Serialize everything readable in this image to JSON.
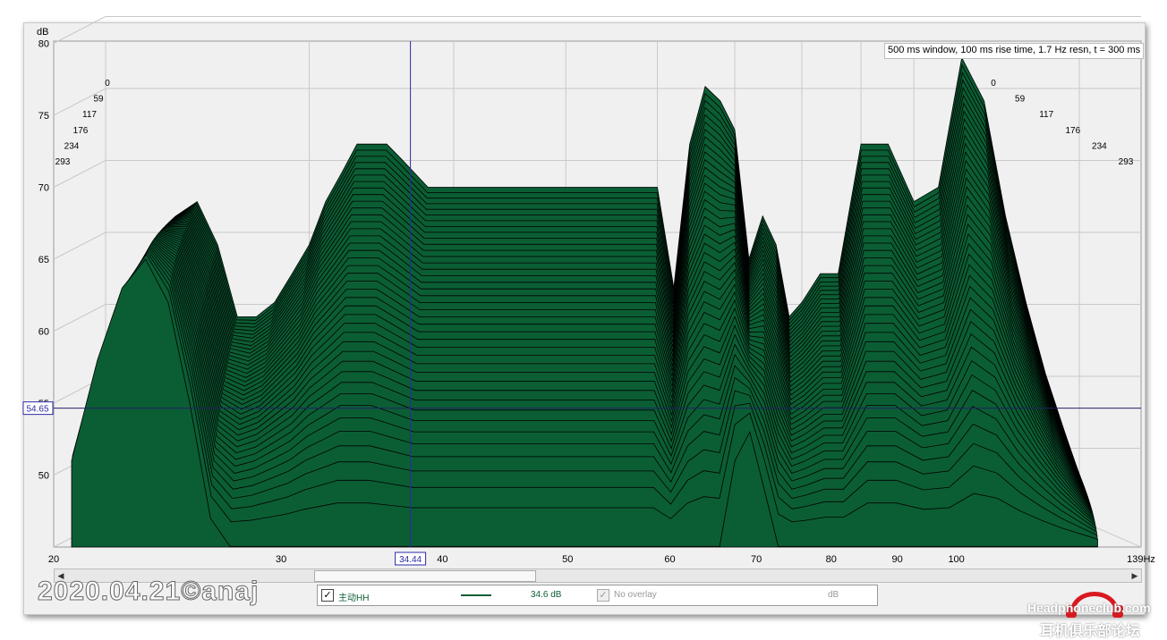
{
  "chart_data": {
    "type": "area",
    "title": "500 ms window, 100 ms rise time,  1.7 Hz resn, t = 300 ms",
    "xlabel": "",
    "ylabel": "dB",
    "xscale": "log",
    "xlim": [
      20,
      139
    ],
    "ylim": [
      45,
      80
    ],
    "x_ticks": [
      "20",
      "30",
      "40",
      "50",
      "60",
      "70",
      "80",
      "90",
      "100",
      "139Hz"
    ],
    "y_ticks": [
      "80",
      "75",
      "70",
      "65",
      "60",
      "55",
      "50"
    ],
    "time_ticks": [
      "0",
      "59",
      "117",
      "176",
      "234",
      "293"
    ],
    "cursor": {
      "x_label": "34.44",
      "y_label": "54.65"
    },
    "fill_color": "#0b5e34",
    "line_color": "#000000",
    "front_slice": {
      "x": [
        20,
        21,
        22,
        23,
        24,
        25,
        26,
        27,
        28,
        29,
        30,
        31,
        32,
        33,
        34,
        35,
        36,
        38,
        40,
        42,
        44,
        46,
        48,
        50,
        52,
        54,
        56,
        58,
        60,
        62,
        64,
        66,
        68,
        70,
        72,
        74,
        76,
        78,
        80,
        83,
        86,
        90,
        95,
        100,
        105,
        110,
        115,
        120,
        125,
        130,
        135,
        139
      ],
      "y": [
        51,
        58,
        63,
        65,
        62,
        55,
        47,
        45,
        45,
        45,
        45,
        45,
        45,
        45,
        45,
        45,
        45,
        45,
        45,
        45,
        45,
        45,
        45,
        45,
        45,
        45,
        45,
        45,
        45,
        45,
        45,
        45,
        45,
        51,
        53,
        49,
        45,
        45,
        45,
        45,
        45,
        45,
        45,
        45,
        45,
        45,
        45,
        45,
        45,
        45,
        45,
        45
      ]
    },
    "back_slice": {
      "x": [
        20,
        21,
        22,
        23,
        24,
        25,
        26,
        27,
        28,
        29,
        30,
        31,
        32,
        33,
        34,
        35,
        36,
        38,
        40,
        42,
        44,
        46,
        48,
        50,
        52,
        54,
        56,
        58,
        60,
        62,
        64,
        66,
        68,
        70,
        72,
        74,
        76,
        78,
        80,
        83,
        86,
        90,
        95,
        100,
        105,
        110,
        115,
        120,
        125,
        130,
        135,
        139
      ],
      "y": [
        54,
        58,
        63,
        68,
        69,
        66,
        61,
        61,
        62,
        64,
        66,
        69,
        71,
        73,
        73,
        73,
        72,
        70,
        70,
        70,
        70,
        70,
        70,
        70,
        70,
        70,
        70,
        70,
        70,
        63,
        73,
        77,
        76,
        74,
        65,
        68,
        66,
        61,
        62,
        64,
        64,
        73,
        73,
        69,
        70,
        79,
        76,
        68,
        62,
        57,
        53,
        50
      ]
    },
    "slices": 40,
    "grid": true
  },
  "legend": {
    "series_label": "主动HH",
    "series_value": "34.6 dB",
    "overlay_label": "No overlay",
    "overlay_unit": "dB"
  },
  "scroll": {
    "left_icon": "arrow-left-icon",
    "right_icon": "arrow-right-icon"
  },
  "watermark": {
    "date": "2020.04.21©anaj",
    "site": "Headphoneclub.com",
    "site_cn": "耳机俱乐部论坛"
  }
}
